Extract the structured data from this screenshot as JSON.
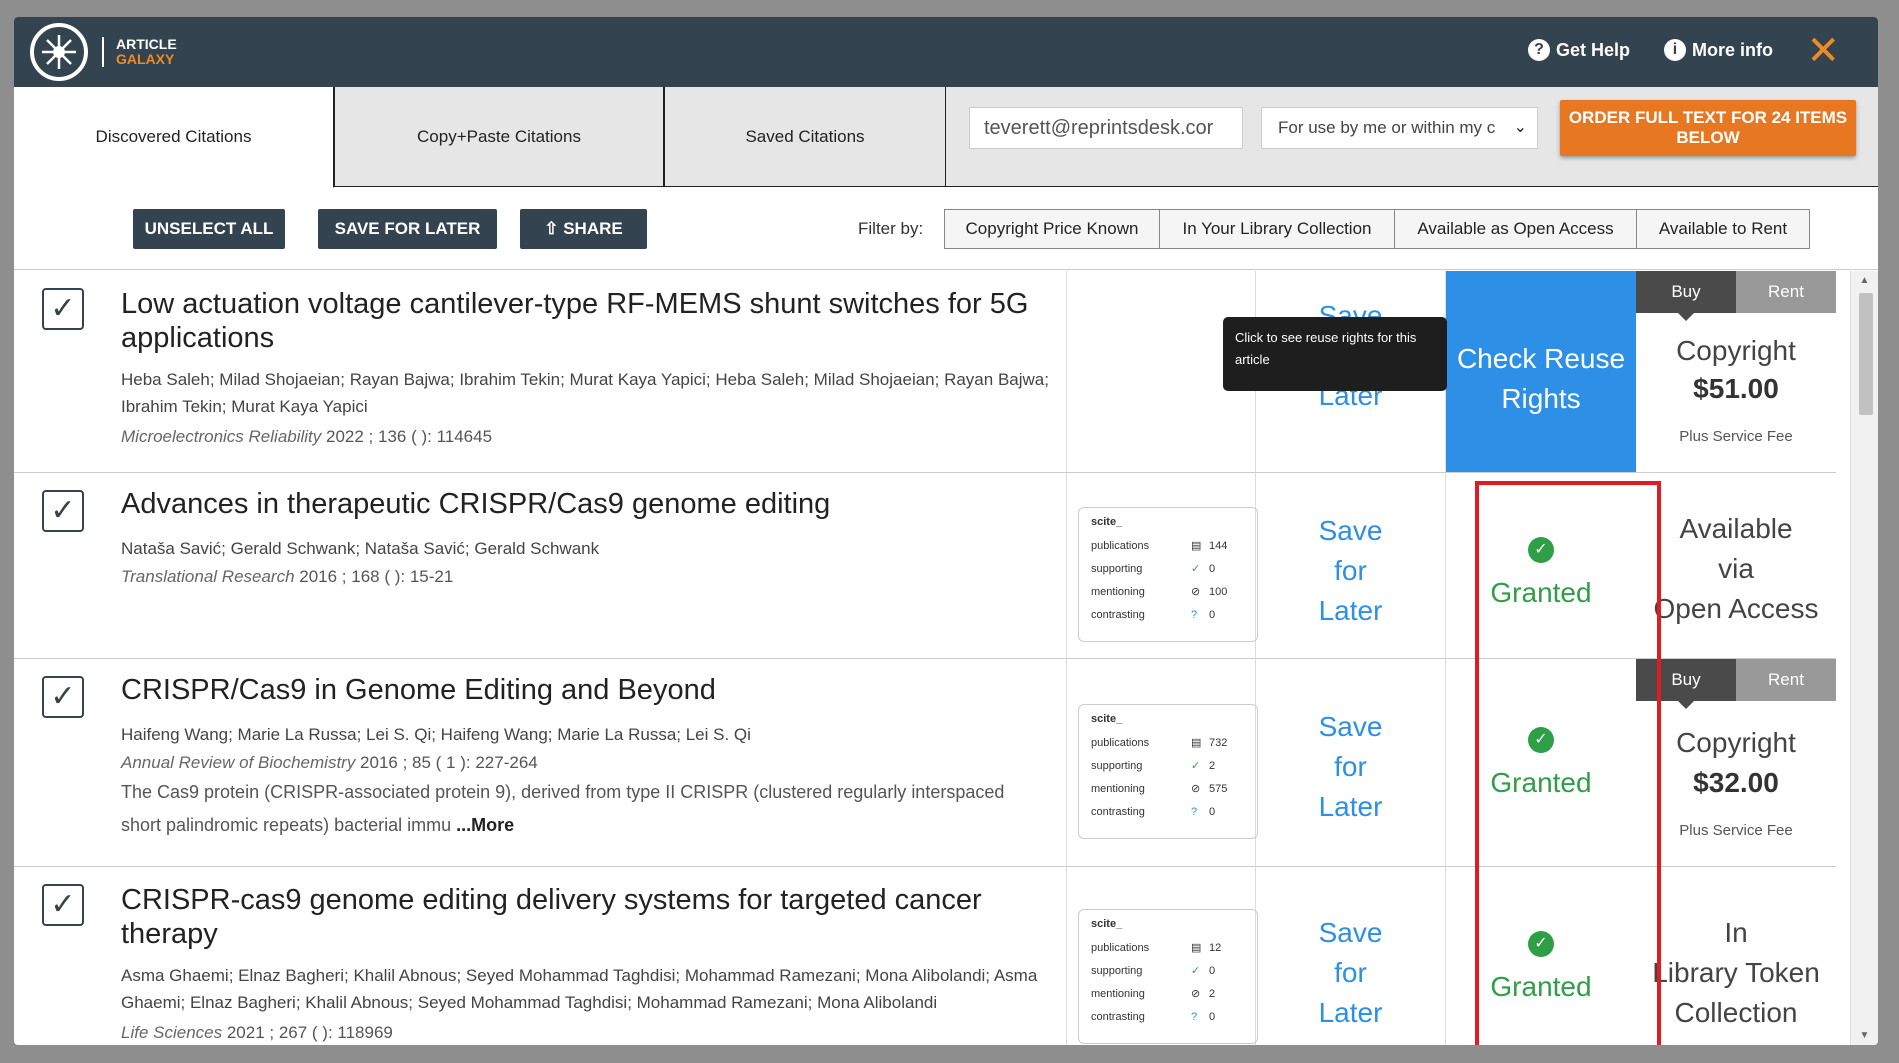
{
  "app": {
    "logo_line1": "ARTICLE",
    "logo_line2": "GALAXY",
    "get_help": "Get Help",
    "more_info": "More info",
    "close": "✕"
  },
  "tabs": [
    {
      "label": "Discovered Citations",
      "active": true
    },
    {
      "label": "Copy+Paste Citations",
      "active": false
    },
    {
      "label": "Saved Citations",
      "active": false
    }
  ],
  "email": {
    "value": "teverett@reprintsdesk.cor"
  },
  "use_select": {
    "value": "For use by me or within my c"
  },
  "order_button": "ORDER FULL TEXT FOR 24 ITEMS BELOW",
  "toolbar": {
    "unselect_all": "UNSELECT ALL",
    "save_for_later": "SAVE FOR LATER",
    "share": "SHARE",
    "filter_label": "Filter by:",
    "filters": [
      "Copyright Price Known",
      "In Your Library Collection",
      "Available as Open Access",
      "Available to Rent"
    ]
  },
  "tooltip": "Click to see reuse rights for this article",
  "scite_labels": {
    "brand": "scite_",
    "publications": "publications",
    "supporting": "supporting",
    "mentioning": "mentioning",
    "contrasting": "contrasting"
  },
  "save_later": {
    "line1": "Save",
    "line2": "for",
    "line3": "Later"
  },
  "check_rights": {
    "line1": "Check Reuse",
    "line2": "Rights"
  },
  "granted": "Granted",
  "buy": "Buy",
  "rent": "Rent",
  "copyright": "Copyright",
  "plus_fee": "Plus Service Fee",
  "articles": [
    {
      "title": "Low actuation voltage cantilever-type RF-MEMS shunt switches for 5G applications",
      "authors": "Heba Saleh; Milad Shojaeian; Rayan Bajwa; Ibrahim Tekin; Murat Kaya Yapici; Heba Saleh; Milad Shojaeian; Rayan Bajwa; Ibrahim Tekin; Murat Kaya Yapici",
      "journal": "Microelectronics Reliability",
      "citation": " 2022 ; 136 ( ): 114645",
      "price": "$51.00"
    },
    {
      "title": "Advances in therapeutic CRISPR/Cas9 genome editing",
      "authors": "Nataša Savić; Gerald Schwank; Nataša Savić; Gerald Schwank",
      "journal": "Translational Research",
      "citation": " 2016 ; 168 ( ): 15-21",
      "scite": {
        "publications": "144",
        "supporting": "0",
        "mentioning": "100",
        "contrasting": "0"
      },
      "status": [
        "Available",
        "via",
        "Open Access"
      ]
    },
    {
      "title": "CRISPR/Cas9 in Genome Editing and Beyond",
      "authors": "Haifeng Wang; Marie La Russa; Lei S. Qi; Haifeng Wang; Marie La Russa; Lei S. Qi",
      "journal": "Annual Review of Biochemistry",
      "citation": " 2016 ; 85 ( 1 ): 227-264",
      "abstract": "The Cas9 protein (CRISPR-associated protein 9), derived from type II CRISPR (clustered regularly interspaced short palindromic repeats) bacterial immu ",
      "more": "...More",
      "scite": {
        "publications": "732",
        "supporting": "2",
        "mentioning": "575",
        "contrasting": "0"
      },
      "price": "$32.00"
    },
    {
      "title": "CRISPR-cas9 genome editing delivery systems for targeted cancer therapy",
      "authors": "Asma Ghaemi; Elnaz Bagheri; Khalil Abnous; Seyed Mohammad Taghdisi; Mohammad Ramezani; Mona Alibolandi; Asma Ghaemi; Elnaz Bagheri; Khalil Abnous; Seyed Mohammad Taghdisi; Mohammad Ramezani; Mona Alibolandi",
      "journal": "Life Sciences",
      "citation": " 2021 ; 267 ( ): 118969",
      "scite": {
        "publications": "12",
        "supporting": "0",
        "mentioning": "2",
        "contrasting": "0"
      },
      "status": [
        "In",
        "Library Token",
        "Collection"
      ]
    }
  ]
}
